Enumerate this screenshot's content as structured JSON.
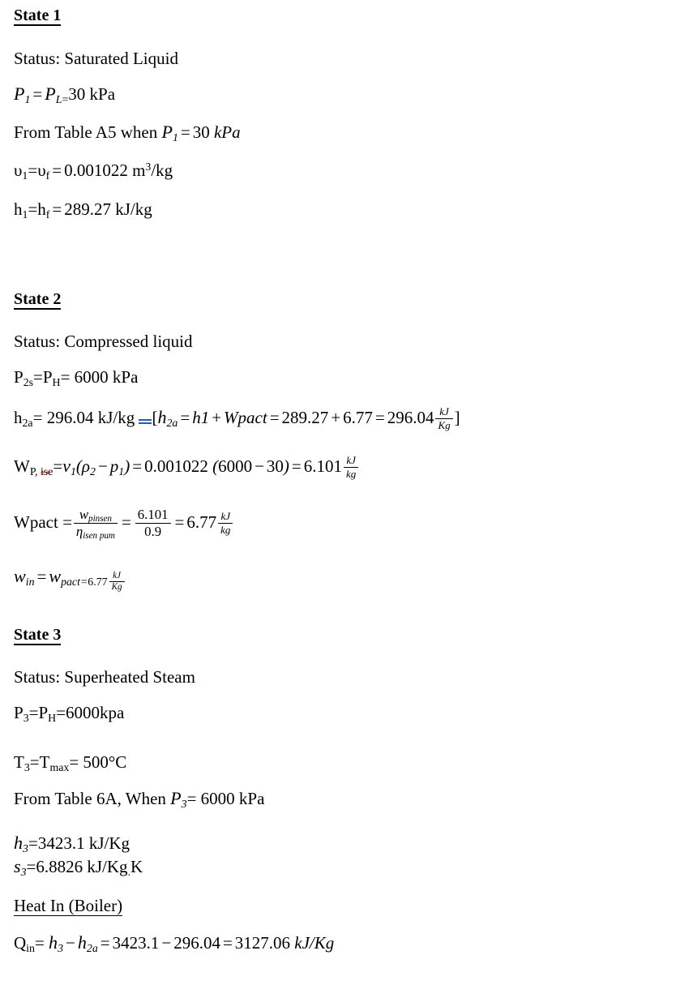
{
  "document": {
    "type": "thermodynamics-handwritten-notes",
    "topic": "Rankine cycle state point analysis"
  },
  "sections": [
    {
      "id": "state-1",
      "heading": "State 1",
      "lines": [
        {
          "id": "s1-status",
          "text": "Status: Saturated Liquid"
        },
        {
          "id": "s1-pressure",
          "text": "P1 = PL= 30 kPa"
        },
        {
          "id": "s1-table",
          "text": "From Table A5 when P1 = 30 kPa"
        },
        {
          "id": "s1-v",
          "text": "v1=vf = 0.001022 m3/kg"
        },
        {
          "id": "s1-h",
          "text": "h1=hf = 289.27 kJ/kg"
        }
      ],
      "values": {
        "P1_kPa": 30,
        "v1_m3_per_kg": 0.001022,
        "h1_kJ_per_kg": 289.27,
        "table": "A5"
      }
    },
    {
      "id": "state-2",
      "heading": "State 2",
      "lines": [
        {
          "id": "s2-status",
          "text": "Status: Compressed liquid"
        },
        {
          "id": "s2-pressure",
          "text": "P2s=PH= 6000 kPa"
        },
        {
          "id": "s2-h2a",
          "text": "h2a= 296.04 kJ/kg [h2a = h1 + Wpact = 289.27 + 6.77 = 296.04 kJ/Kg]"
        },
        {
          "id": "s2-wpise",
          "text": "WP, ise= v1(p2 - p1) = 0.001022 (6000 - 30) = 6.101 kJ/kg"
        },
        {
          "id": "s2-wpact",
          "text": "Wpact = wpinsen / nisen pum = 6.101 / 0.9 = 6.77 kJ/kg"
        },
        {
          "id": "s2-win",
          "text": "win = wpact=6.77 kJ/Kg"
        }
      ],
      "values": {
        "P2s_kPa": 6000,
        "h2a_kJ_per_kg": 296.04,
        "wp_isentropic_kJ_per_kg": 6.101,
        "pump_isentropic_efficiency": 0.9,
        "wp_actual_kJ_per_kg": 6.77
      }
    },
    {
      "id": "state-3",
      "heading": "State 3",
      "lines": [
        {
          "id": "s3-status",
          "text": "Status: Superheated Steam"
        },
        {
          "id": "s3-pressure",
          "text": "P3=PH=6000kpa"
        },
        {
          "id": "s3-temp",
          "text": "T3=Tmax= 500°C"
        },
        {
          "id": "s3-table",
          "text": "From Table 6A, When P3= 6000 kPa"
        },
        {
          "id": "s3-h",
          "text": "h3=3423.1 kJ/Kg"
        },
        {
          "id": "s3-s",
          "text": "s3=6.8826 kJ/Kg.K"
        }
      ],
      "values": {
        "P3_kPa": 6000,
        "T3_C": 500,
        "h3_kJ_per_kg": 3423.1,
        "s3_kJ_per_kgK": 6.8826,
        "table": "6A"
      }
    },
    {
      "id": "heat-in",
      "heading": "Heat In (Boiler)",
      "lines": [
        {
          "id": "qin",
          "text": "Qin= h3 - h2a = 3423.1 - 296.04 = 3127.06 kJ/Kg"
        }
      ],
      "values": {
        "q_in_kJ_per_kg": 3127.06
      }
    }
  ],
  "tokens": {
    "state1_heading": "State 1",
    "state2_heading": "State 2",
    "state3_heading": "State 3",
    "heat_in_heading": "Heat In (Boiler)",
    "status_label": "Status:",
    "status_s1": " Status: Saturated Liquid",
    "status_s2": "Status: Compressed liquid",
    "status_s3": "Status: Superheated Steam",
    "P": "P",
    "h": "h",
    "v": "υ",
    "s": "s",
    "T": "T",
    "W": "W",
    "w": "w",
    "Q": "Q",
    "eta": "η",
    "rho": "ρ",
    "eq": "=",
    "plus": "+",
    "minus": "−",
    "sub_1": "1",
    "sub_2": "2",
    "sub_3": "3",
    "sub_L": "L",
    "sub_H": "H",
    "sub_f": "f",
    "sub_2a": "2a",
    "sub_2s": "2s",
    "sub_in": "in",
    "sub_max": "max",
    "sub_a": "a",
    "sub_s": "s",
    "val_30": "30",
    "val_6000": "6000",
    "val_500": "500",
    "val_0001022": "0.001022",
    "val_28927": "289.27",
    "val_29604": "296.04",
    "val_6101": "6.101",
    "val_677": "6.77",
    "val_09": "0.9",
    "val_34231": "3423.1",
    "val_312706": "3127.06",
    "val_68826": "6.8826",
    "unit_kPa": "kPa",
    "unit_kPa_italic": "kPa",
    "unit_kpa_lower": "kpa",
    "unit_kJkg": "kJ/kg",
    "unit_kJKg": "kJ/Kg",
    "unit_kJ": "kJ",
    "unit_kg": "kg",
    "unit_Kg": "Kg",
    "unit_m3kg_m": "m",
    "unit_m3kg_sup": "3",
    "unit_m3kg_rest": "/kg",
    "unit_degC": "°C",
    "unit_KgK": "kJ/Kg",
    "unit_K": "K",
    "from_table_a5": "From Table A5 when",
    "from_table_6a": "From Table 6A, When",
    "wpact_label": "W",
    "wpact_rest": "pact",
    "wp_label": "W",
    "wp_sub_pre": "P, ",
    "wp_sub_ise": "ise",
    "num_wpinsen": "w",
    "num_wpinsen_sub": "pinsen",
    "den_eta": "η",
    "den_eta_sub": "isen pum",
    "Tmax": "max",
    "Wpact_italic": "Wpact",
    "h1_plain": "h1",
    "bracket_open": "[",
    "bracket_close": "]"
  },
  "colors": {
    "text": "#000000",
    "background": "#ffffff",
    "spellcheck_underline": "#e03030",
    "edit_mark": "#2a5db0"
  }
}
